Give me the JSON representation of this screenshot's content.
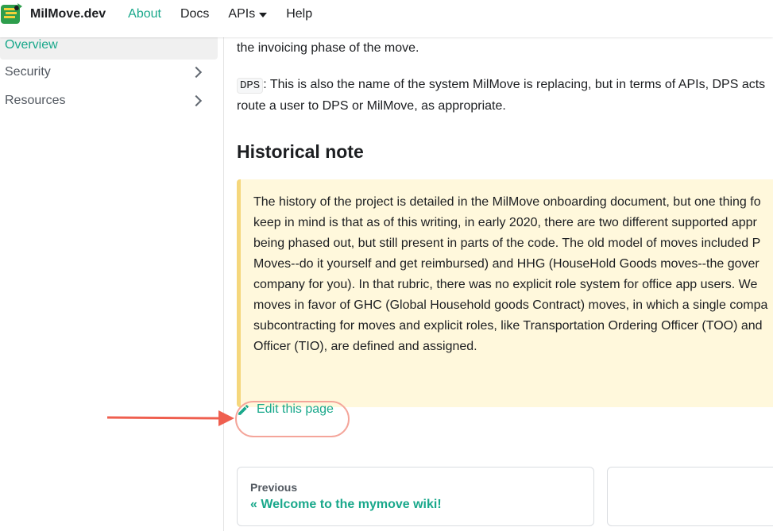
{
  "navbar": {
    "brand": "MilMove.dev",
    "items": [
      "About",
      "Docs",
      "APIs",
      "Help"
    ],
    "active": "About"
  },
  "sidebar": {
    "items": [
      {
        "label": "Overview",
        "active": true
      },
      {
        "label": "Security",
        "active": false
      },
      {
        "label": "Resources",
        "active": false
      }
    ]
  },
  "content": {
    "para1": "the invoicing phase of the move.",
    "dps_code": "DPS",
    "para2_rest": ": This is also the name of the system MilMove is replacing, but in terms of APIs, DPS acts",
    "para2_line2": "route a user to DPS or MilMove, as appropriate.",
    "heading": "Historical note",
    "note_lines": [
      "The history of the project is detailed in the MilMove onboarding document, but one thing fo",
      "keep in mind is that as of this writing, in early 2020, there are two different supported appr",
      "being phased out, but still present in parts of the code. The old model of moves included P",
      "Moves--do it yourself and get reimbursed) and HHG (HouseHold Goods moves--the gover",
      "company for you). In that rubric, there was no explicit role system for office app users. We",
      "moves in favor of GHC (Global Household goods Contract) moves, in which a single compa",
      "subcontracting for moves and explicit roles, like Transportation Ordering Officer (TOO) and",
      "Officer (TIO), are defined and assigned."
    ],
    "edit_link": "Edit this page"
  },
  "pager": {
    "prev_sub": "Previous",
    "prev_title": "« Welcome to the mymove wiki!"
  },
  "colors": {
    "accent": "#19a88b",
    "admonition_bg": "#fff8dc",
    "admonition_border": "#f5d77c",
    "annotation": "#ef5f4f"
  }
}
